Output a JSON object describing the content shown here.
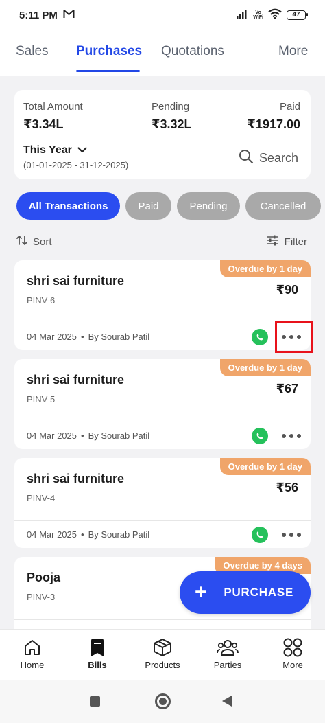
{
  "status_bar": {
    "time": "5:11 PM",
    "network_label_top": "Vo",
    "network_label_bottom": "WiFi",
    "battery": "47"
  },
  "top_tabs": [
    {
      "label": "Sales"
    },
    {
      "label": "Purchases",
      "active": true
    },
    {
      "label": "Quotations"
    },
    {
      "label": "More"
    }
  ],
  "summary": {
    "total_label": "Total Amount",
    "total_value": "₹3.34L",
    "pending_label": "Pending",
    "pending_value": "₹3.32L",
    "paid_label": "Paid",
    "paid_value": "₹1917.00",
    "period": "This Year",
    "range": "(01-01-2025 - 31-12-2025)",
    "search_label": "Search"
  },
  "filters": [
    {
      "label": "All Transactions",
      "active": true
    },
    {
      "label": "Paid"
    },
    {
      "label": "Pending"
    },
    {
      "label": "Cancelled"
    }
  ],
  "sort_label": "Sort",
  "filter_label": "Filter",
  "transactions": [
    {
      "party": "shri sai furniture",
      "invoice": "PINV-6",
      "amount": "₹90",
      "status": "Overdue by 1 day",
      "date": "04 Mar 2025",
      "by": "By Sourab Patil"
    },
    {
      "party": "shri sai furniture",
      "invoice": "PINV-5",
      "amount": "₹67",
      "status": "Overdue by 1 day",
      "date": "04 Mar 2025",
      "by": "By Sourab Patil"
    },
    {
      "party": "shri sai furniture",
      "invoice": "PINV-4",
      "amount": "₹56",
      "status": "Overdue by 1 day",
      "date": "04 Mar 2025",
      "by": "By Sourab Patil"
    },
    {
      "party": "Pooja",
      "invoice": "PINV-3",
      "amount": "",
      "status": "Overdue by 4 days",
      "date": "",
      "by": ""
    }
  ],
  "fab_label": "PURCHASE",
  "bottom_nav": [
    {
      "label": "Home",
      "icon": "home-icon"
    },
    {
      "label": "Bills",
      "icon": "bills-icon",
      "active": true
    },
    {
      "label": "Products",
      "icon": "box-icon"
    },
    {
      "label": "Parties",
      "icon": "people-icon"
    },
    {
      "label": "More",
      "icon": "grid-icon"
    }
  ],
  "colors": {
    "accent": "#2b4df0",
    "overdue": "#f0a56a",
    "whatsapp": "#25c15b",
    "highlight": "#e8121b"
  }
}
